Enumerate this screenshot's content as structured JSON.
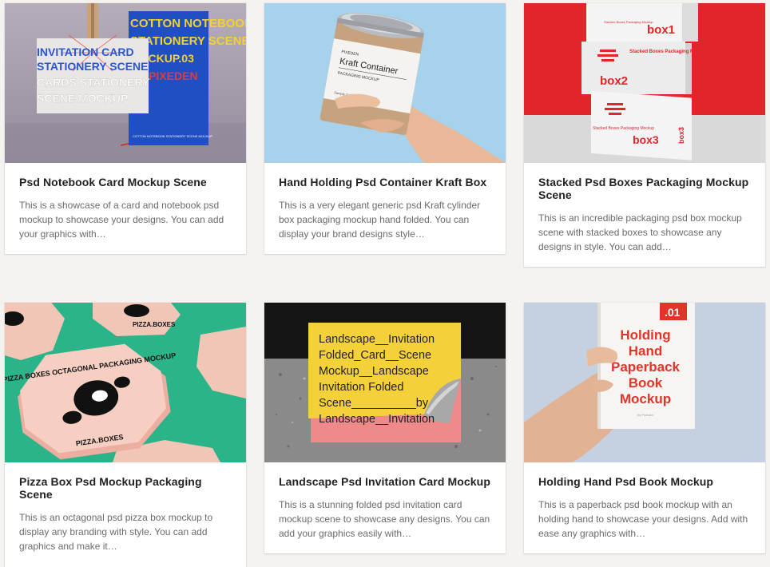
{
  "cards": [
    {
      "title": "Psd Notebook Card Mockup Scene",
      "excerpt": "This is a showcase of a card and notebook psd mockup to showcase your designs. You can add your graphics with…",
      "image": {
        "card_lines": [
          "INVITATION CARD",
          "STATIONERY SCENE",
          "CARDS STATIONERY",
          "SCENE MOCKUP"
        ],
        "book_lines": [
          "COTTON NOTEBOOK",
          "STATIONERY SCENE",
          "MOCKUP.03",
          "BY PIXEDEN"
        ],
        "book_subtext": "COTTON NOTEBOOK STATIONERY SCENE MOCKUP"
      }
    },
    {
      "title": "Hand Holding Psd Container Kraft Box",
      "excerpt": "This is a very elegant generic psd Kraft cylinder box packaging mockup hand folded. You can display your brand designs style…",
      "image": {
        "label_lines": [
          "PIXEDEN",
          "Kraft Container",
          "PACKAGING MOCKUP",
          "Sample Content"
        ]
      }
    },
    {
      "title": "Stacked Psd Boxes Packaging Mockup Scene",
      "excerpt": "This is an incredible packaging psd box mockup scene with stacked boxes to showcase any designs in style. You can add…",
      "image": {
        "box_labels": [
          "box1",
          "box2",
          "box3"
        ],
        "box_subtext": [
          "Stacked Boxes Packaging Mockup",
          "Stacked Boxes Packaging Mockup",
          "Stacked Boxes Packaging Mockup"
        ]
      }
    },
    {
      "title": "Pizza Box Psd Mockup Packaging Scene",
      "excerpt": "This is an octagonal psd pizza box mockup to display any branding with style. You can add graphics and make it…",
      "image": {
        "box_text_top": "PIZZA BOXES OCTAGONAL PACKAGING MOCKUP",
        "box_text_side": "PIZZA.BOXES"
      }
    },
    {
      "title": "Landscape Psd Invitation Card Mockup",
      "excerpt": "This is a stunning folded psd invitation card mockup scene to showcase any designs. You can add your graphics easily with…",
      "image": {
        "card_lines": [
          "Landscape__Invitation",
          "Folded_Card__Scene",
          "Mockup__Landscape",
          "Invitation Folded",
          "Scene__________by",
          "Landscape__Invitation"
        ]
      }
    },
    {
      "title": "Holding Hand Psd Book Mockup",
      "excerpt": "This is a paperback psd book mockup with an holding hand to showcase your designs. Add with ease any graphics with…",
      "image": {
        "badge": ".01",
        "book_lines": [
          "Holding",
          "Hand",
          "Paperback",
          "Book",
          "Mockup"
        ],
        "book_subtext": "by Pixeden"
      }
    }
  ]
}
